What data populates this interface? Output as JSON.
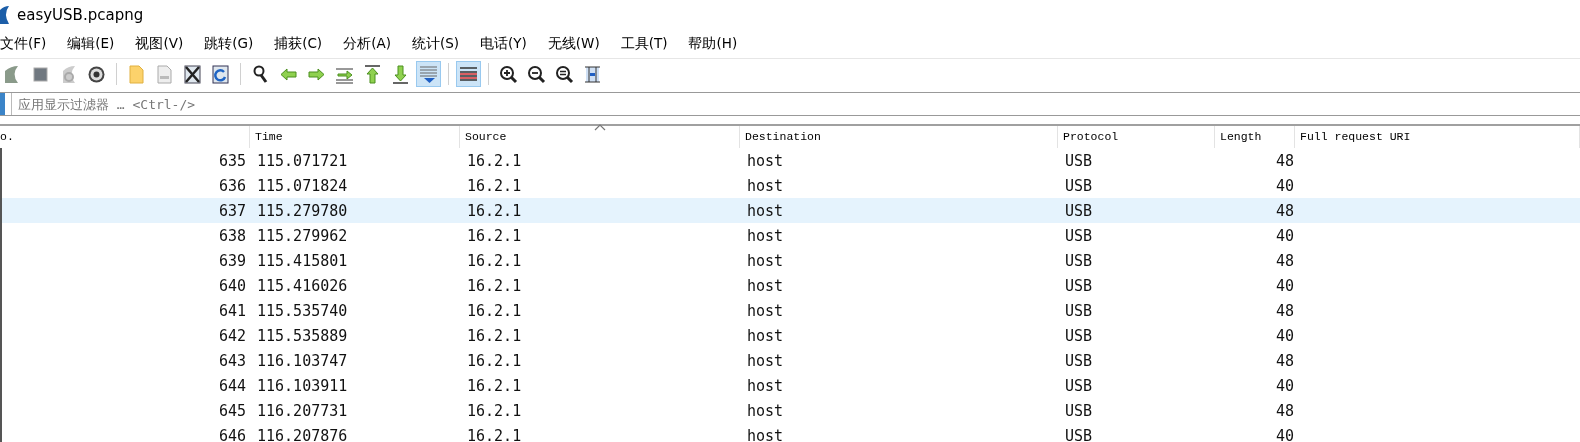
{
  "window": {
    "title": "easyUSB.pcapng"
  },
  "menu": [
    "文件(F)",
    "编辑(E)",
    "视图(V)",
    "跳转(G)",
    "捕获(C)",
    "分析(A)",
    "统计(S)",
    "电话(Y)",
    "无线(W)",
    "工具(T)",
    "帮助(H)"
  ],
  "toolbar": [
    {
      "kind": "fin",
      "pressed": false
    },
    {
      "kind": "stop",
      "pressed": false
    },
    {
      "kind": "restart",
      "pressed": false
    },
    {
      "kind": "gear",
      "pressed": false
    },
    {
      "kind": "separator"
    },
    {
      "kind": "folder",
      "pressed": false
    },
    {
      "kind": "file",
      "pressed": false
    },
    {
      "kind": "close",
      "pressed": false
    },
    {
      "kind": "reload",
      "pressed": false
    },
    {
      "kind": "separator"
    },
    {
      "kind": "search",
      "pressed": false
    },
    {
      "kind": "back",
      "pressed": false
    },
    {
      "kind": "forward",
      "pressed": false
    },
    {
      "kind": "goto",
      "pressed": false
    },
    {
      "kind": "first",
      "pressed": false
    },
    {
      "kind": "last",
      "pressed": false
    },
    {
      "kind": "autoscroll",
      "pressed": true
    },
    {
      "kind": "separator"
    },
    {
      "kind": "colorize",
      "pressed": true
    },
    {
      "kind": "separator"
    },
    {
      "kind": "zoomin",
      "pressed": false
    },
    {
      "kind": "zoomout",
      "pressed": false
    },
    {
      "kind": "zoomreset",
      "pressed": false
    },
    {
      "kind": "resize",
      "pressed": false
    }
  ],
  "filter": {
    "placeholder": "应用显示过滤器 … <Ctrl-/>"
  },
  "table": {
    "columns": [
      {
        "label": "o.",
        "sorted": false
      },
      {
        "label": "Time",
        "sorted": false
      },
      {
        "label": "Source",
        "sorted": true
      },
      {
        "label": "Destination",
        "sorted": false
      },
      {
        "label": "Protocol",
        "sorted": false
      },
      {
        "label": "Length",
        "sorted": false
      },
      {
        "label": "Full request URI",
        "sorted": false
      }
    ],
    "rows": [
      {
        "cells": [
          "635",
          "115.071721",
          "16.2.1",
          "host",
          "USB",
          "48",
          ""
        ],
        "selected": false
      },
      {
        "cells": [
          "636",
          "115.071824",
          "16.2.1",
          "host",
          "USB",
          "40",
          ""
        ],
        "selected": false
      },
      {
        "cells": [
          "637",
          "115.279780",
          "16.2.1",
          "host",
          "USB",
          "48",
          ""
        ],
        "selected": true
      },
      {
        "cells": [
          "638",
          "115.279962",
          "16.2.1",
          "host",
          "USB",
          "40",
          ""
        ],
        "selected": false
      },
      {
        "cells": [
          "639",
          "115.415801",
          "16.2.1",
          "host",
          "USB",
          "48",
          ""
        ],
        "selected": false
      },
      {
        "cells": [
          "640",
          "115.416026",
          "16.2.1",
          "host",
          "USB",
          "40",
          ""
        ],
        "selected": false
      },
      {
        "cells": [
          "641",
          "115.535740",
          "16.2.1",
          "host",
          "USB",
          "48",
          ""
        ],
        "selected": false
      },
      {
        "cells": [
          "642",
          "115.535889",
          "16.2.1",
          "host",
          "USB",
          "40",
          ""
        ],
        "selected": false
      },
      {
        "cells": [
          "643",
          "116.103747",
          "16.2.1",
          "host",
          "USB",
          "48",
          ""
        ],
        "selected": false
      },
      {
        "cells": [
          "644",
          "116.103911",
          "16.2.1",
          "host",
          "USB",
          "40",
          ""
        ],
        "selected": false
      },
      {
        "cells": [
          "645",
          "116.207731",
          "16.2.1",
          "host",
          "USB",
          "48",
          ""
        ],
        "selected": false
      },
      {
        "cells": [
          "646",
          "116.207876",
          "16.2.1",
          "host",
          "USB",
          "40",
          ""
        ],
        "selected": false
      }
    ]
  }
}
